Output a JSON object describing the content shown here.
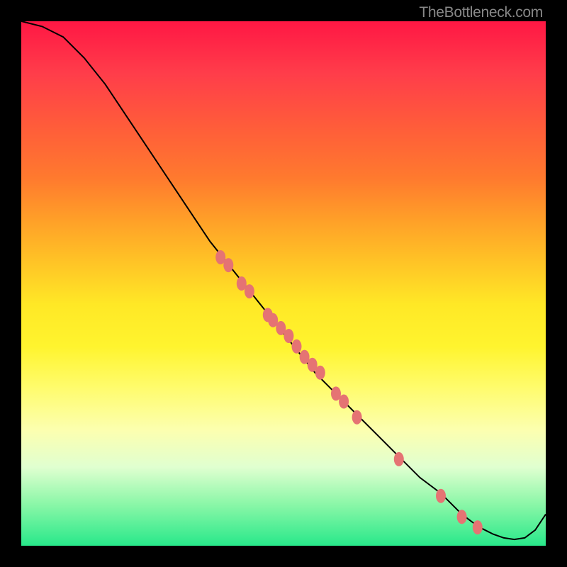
{
  "watermark": "TheBottleneck.com",
  "chart_data": {
    "type": "line",
    "title": "",
    "xlabel": "",
    "ylabel": "",
    "xlim": [
      0,
      100
    ],
    "ylim": [
      0,
      100
    ],
    "series": [
      {
        "name": "curve",
        "x": [
          0,
          4,
          8,
          12,
          16,
          20,
          24,
          28,
          32,
          36,
          40,
          44,
          48,
          52,
          56,
          60,
          64,
          68,
          72,
          76,
          80,
          84,
          86,
          88,
          90,
          92,
          94,
          96,
          98,
          100
        ],
        "values": [
          100,
          99,
          97,
          93,
          88,
          82,
          76,
          70,
          64,
          58,
          53,
          48,
          43,
          38,
          33,
          29,
          25,
          21,
          17,
          13,
          10,
          6,
          4.5,
          3.2,
          2.2,
          1.5,
          1.2,
          1.5,
          3,
          6
        ]
      }
    ],
    "markers": {
      "name": "highlighted-points",
      "color": "#e57373",
      "x": [
        38,
        39.5,
        42,
        43.5,
        47,
        48,
        49.5,
        51,
        52.5,
        54,
        55.5,
        57,
        60,
        61.5,
        64,
        72,
        80,
        84,
        87
      ],
      "values": [
        55,
        53.5,
        50,
        48.5,
        44,
        43,
        41.5,
        40,
        38,
        36,
        34.5,
        33,
        29,
        27.5,
        24.5,
        16.5,
        9.5,
        5.5,
        3.5
      ]
    }
  }
}
